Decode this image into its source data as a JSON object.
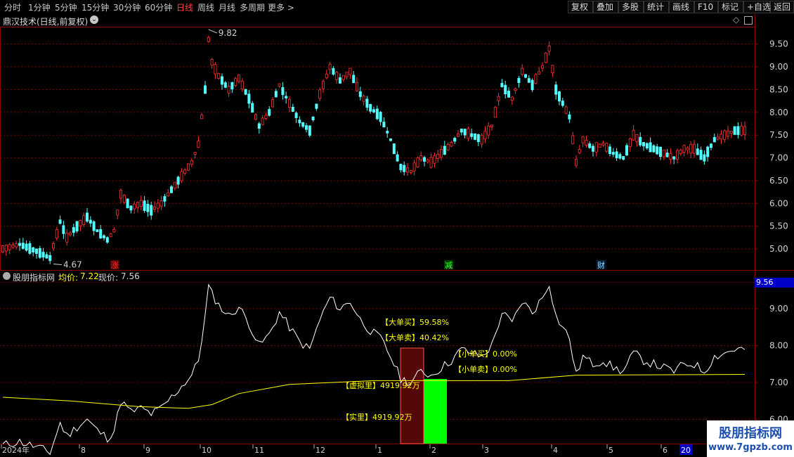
{
  "toolbar": {
    "periods": [
      "分时",
      "1分钟",
      "5分钟",
      "15分钟",
      "30分钟",
      "60分钟",
      "日线",
      "周线",
      "月线",
      "多周期",
      "更多 >"
    ],
    "active_period": "日线",
    "right_buttons": [
      "复权",
      "叠加",
      "多股",
      "统计",
      "画线",
      "F10",
      "标记",
      "+自选",
      "返回"
    ]
  },
  "main_panel": {
    "stock_name": "鼎汉技术(日线,前复权)",
    "high_marker": "9.82",
    "low_marker": "4.67",
    "event_markers": [
      {
        "label": "涨",
        "color": "#ff3030",
        "bg": "#5a0000"
      },
      {
        "label": "减",
        "color": "#40ff40",
        "bg": "#003a00"
      },
      {
        "label": "财",
        "color": "#8fd8ff",
        "bg": "#00203a"
      }
    ]
  },
  "indicator_panel": {
    "name": "股朋指标网",
    "avg_label": "均价:",
    "avg_value": "7.22",
    "cur_label": "现价:",
    "cur_value": "7.56",
    "current_tag": "9.56",
    "big_buy": "【大单买】59.58%",
    "big_sell": "【大单卖】40.42%",
    "small_buy": "【小单买】0.00%",
    "small_sell": "【小单卖】0.00%",
    "virtual_vol": "【虚拟里】4919.92万",
    "real_vol": "【实里】4919.92万"
  },
  "date_axis": {
    "year_label": "2024年",
    "months": [
      "8",
      "9",
      "10",
      "11",
      "12",
      "1",
      "2",
      "3",
      "4",
      "5",
      "6"
    ],
    "current_tag": "20"
  },
  "watermark": {
    "title": "股朋指标网",
    "url": "www.7gpzb.com"
  },
  "colors": {
    "up": "#ff3030",
    "down": "#54ffff",
    "avg_line": "#ffff00",
    "grid": "#7a0000",
    "panel_border": "#8b0000",
    "highlight": "#ffff00"
  },
  "chart_data": {
    "type": "candlestick",
    "price_axis": {
      "ticks": [
        5.0,
        5.5,
        6.0,
        6.5,
        7.0,
        7.5,
        8.0,
        8.5,
        9.0,
        9.5
      ],
      "range": [
        4.6,
        9.85
      ]
    },
    "indicator_axis": {
      "ticks": [
        6.0,
        7.0,
        8.0,
        9.0
      ],
      "range": [
        5.4,
        9.65
      ]
    },
    "x_categories": [
      "2024-07",
      "8",
      "9",
      "10",
      "11",
      "12",
      "1",
      "2",
      "3",
      "4",
      "5",
      "6"
    ],
    "price_path": [
      [
        0,
        5.0
      ],
      [
        5,
        5.1
      ],
      [
        10,
        4.95
      ],
      [
        14,
        4.8
      ],
      [
        17,
        5.6
      ],
      [
        19,
        5.25
      ],
      [
        22,
        5.5
      ],
      [
        25,
        5.7
      ],
      [
        28,
        5.4
      ],
      [
        31,
        5.2
      ],
      [
        33,
        5.4
      ],
      [
        35,
        6.2
      ],
      [
        38,
        5.9
      ],
      [
        41,
        6.0
      ],
      [
        44,
        5.85
      ],
      [
        47,
        6.0
      ],
      [
        50,
        6.3
      ],
      [
        53,
        6.6
      ],
      [
        56,
        6.9
      ],
      [
        58,
        7.3
      ],
      [
        60,
        8.5
      ],
      [
        61,
        9.6
      ],
      [
        62,
        9.1
      ],
      [
        64,
        8.8
      ],
      [
        67,
        8.5
      ],
      [
        70,
        8.75
      ],
      [
        73,
        8.3
      ],
      [
        76,
        7.7
      ],
      [
        79,
        8.0
      ],
      [
        82,
        8.6
      ],
      [
        85,
        8.2
      ],
      [
        88,
        7.8
      ],
      [
        91,
        7.6
      ],
      [
        94,
        8.4
      ],
      [
        97,
        9.0
      ],
      [
        100,
        8.7
      ],
      [
        103,
        8.9
      ],
      [
        106,
        8.4
      ],
      [
        109,
        8.1
      ],
      [
        112,
        7.9
      ],
      [
        115,
        7.4
      ],
      [
        118,
        6.8
      ],
      [
        121,
        6.7
      ],
      [
        124,
        7.0
      ],
      [
        127,
        6.9
      ],
      [
        130,
        7.1
      ],
      [
        133,
        7.3
      ],
      [
        136,
        7.6
      ],
      [
        139,
        7.5
      ],
      [
        142,
        7.4
      ],
      [
        145,
        7.7
      ],
      [
        148,
        8.6
      ],
      [
        151,
        8.3
      ],
      [
        154,
        8.9
      ],
      [
        157,
        8.6
      ],
      [
        160,
        9.0
      ],
      [
        162,
        9.4
      ],
      [
        164,
        8.5
      ],
      [
        166,
        8.2
      ],
      [
        168,
        7.9
      ],
      [
        170,
        6.9
      ],
      [
        172,
        7.4
      ],
      [
        175,
        7.2
      ],
      [
        178,
        7.3
      ],
      [
        181,
        7.1
      ],
      [
        184,
        7.0
      ],
      [
        187,
        7.5
      ],
      [
        190,
        7.3
      ],
      [
        193,
        7.2
      ],
      [
        196,
        7.1
      ],
      [
        199,
        7.0
      ],
      [
        202,
        7.2
      ],
      [
        205,
        7.2
      ],
      [
        208,
        7.0
      ],
      [
        211,
        7.4
      ],
      [
        214,
        7.5
      ],
      [
        217,
        7.6
      ],
      [
        220,
        7.6
      ]
    ],
    "avg_path": [
      [
        0,
        6.6
      ],
      [
        20,
        6.5
      ],
      [
        40,
        6.35
      ],
      [
        55,
        6.3
      ],
      [
        62,
        6.4
      ],
      [
        70,
        6.7
      ],
      [
        85,
        6.95
      ],
      [
        110,
        7.05
      ],
      [
        130,
        7.05
      ],
      [
        150,
        7.05
      ],
      [
        170,
        7.2
      ],
      [
        220,
        7.22
      ]
    ],
    "bars": {
      "big_buy_pct": 59.58,
      "big_sell_pct": 40.42,
      "small_buy_pct": 0.0,
      "small_sell_pct": 0.0
    },
    "volume": {
      "virtual": "4919.92万",
      "real": "4919.92万"
    }
  }
}
